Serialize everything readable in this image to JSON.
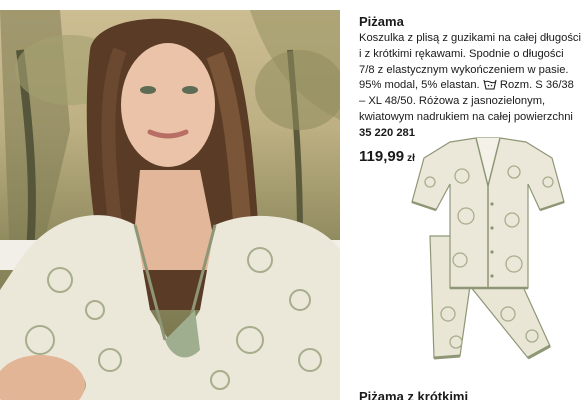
{
  "product": {
    "name": "Piżama",
    "description_before_icon": "Koszulka z plisą z guzikami na całej długości i z krótkimi rękawami. Spodnie o długości 7/8 z elastycznym wykończeniem w pasie. 95% modal, 5% elastan.",
    "description_after_icon": "Rozm. S 36/38 – XL 48/50. Różowa z jasnozielonym, kwiatowym nadrukiem na całej powierzchni",
    "sku": "35 220 281",
    "price": "119,99",
    "currency": "zł",
    "care_icon": "washing-tub-icon"
  },
  "next_product": {
    "title": "Piżama z krótkimi"
  },
  "colors": {
    "fabric": "#e9e6d6",
    "print": "#a8ad8c",
    "piping": "#8f9676"
  }
}
